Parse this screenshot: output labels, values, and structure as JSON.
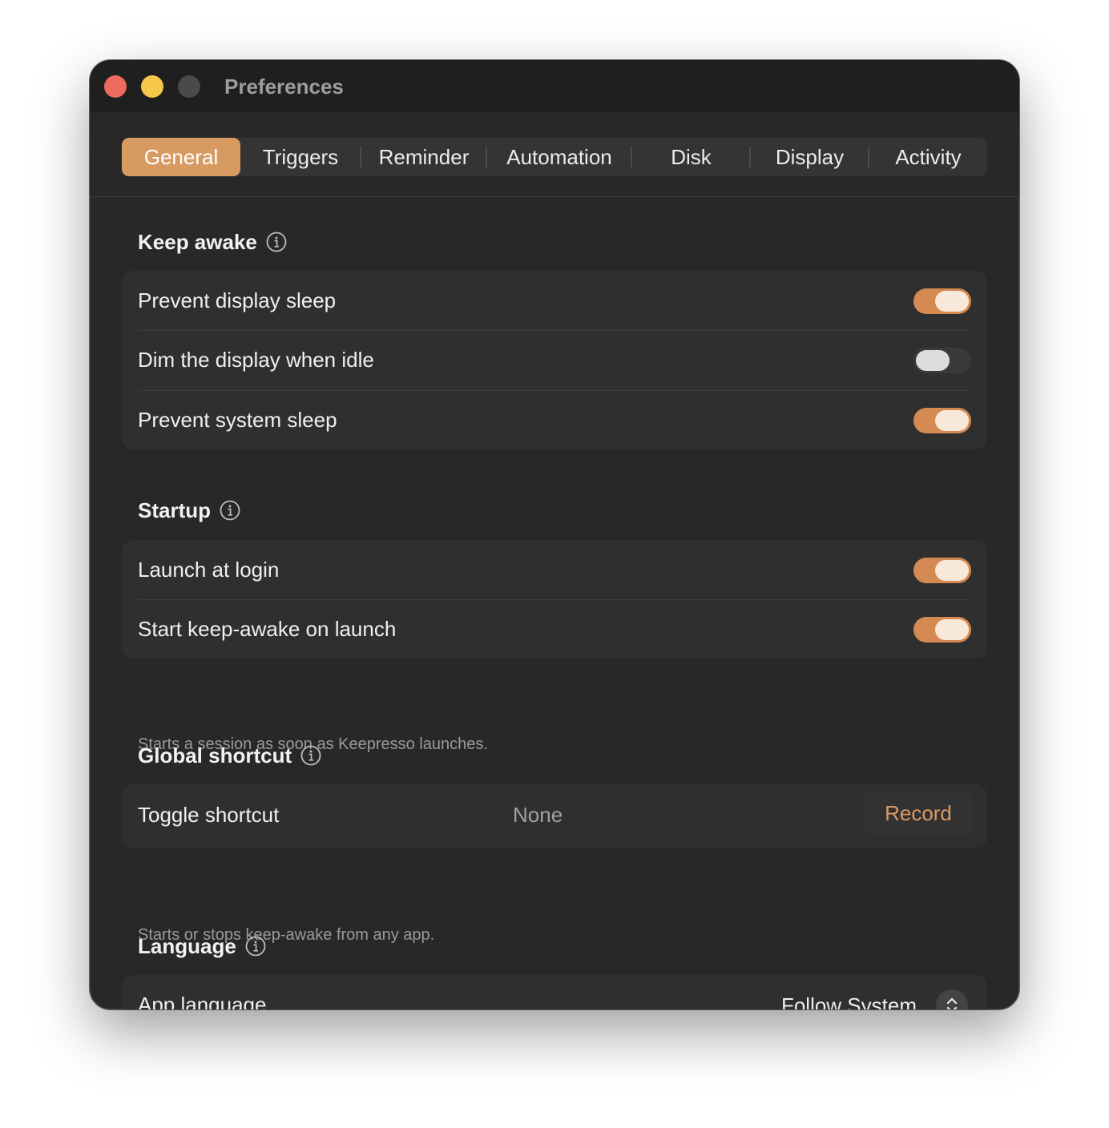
{
  "window": {
    "title": "Preferences"
  },
  "tabs": [
    {
      "label": "General",
      "active": true
    },
    {
      "label": "Triggers",
      "active": false
    },
    {
      "label": "Reminder",
      "active": false
    },
    {
      "label": "Automation",
      "active": false
    },
    {
      "label": "Disk",
      "active": false
    },
    {
      "label": "Display",
      "active": false
    },
    {
      "label": "Activity",
      "active": false
    }
  ],
  "keep_awake": {
    "title": "Keep awake",
    "rows": [
      {
        "label": "Prevent display sleep",
        "on": true
      },
      {
        "label": "Dim the display when idle",
        "on": false
      },
      {
        "label": "Prevent system sleep",
        "on": true
      }
    ]
  },
  "startup": {
    "title": "Startup",
    "rows": [
      {
        "label": "Launch at login",
        "on": true
      },
      {
        "label": "Start keep-awake on launch",
        "on": true
      }
    ],
    "helper": "Starts a session as soon as Keepresso launches."
  },
  "global_shortcut": {
    "title": "Global shortcut",
    "row_label": "Toggle shortcut",
    "value": "None",
    "button": "Record",
    "helper": "Starts or stops keep-awake from any app."
  },
  "language": {
    "title": "Language",
    "row_label": "App language",
    "value": "Follow System"
  },
  "colors": {
    "accent": "#d79a61",
    "toggle_on": "#d48a52",
    "window_bg": "#282828"
  },
  "icons": {
    "section_info": "info-circle-icon",
    "select_chevron": "chevron-up-down-icon"
  }
}
